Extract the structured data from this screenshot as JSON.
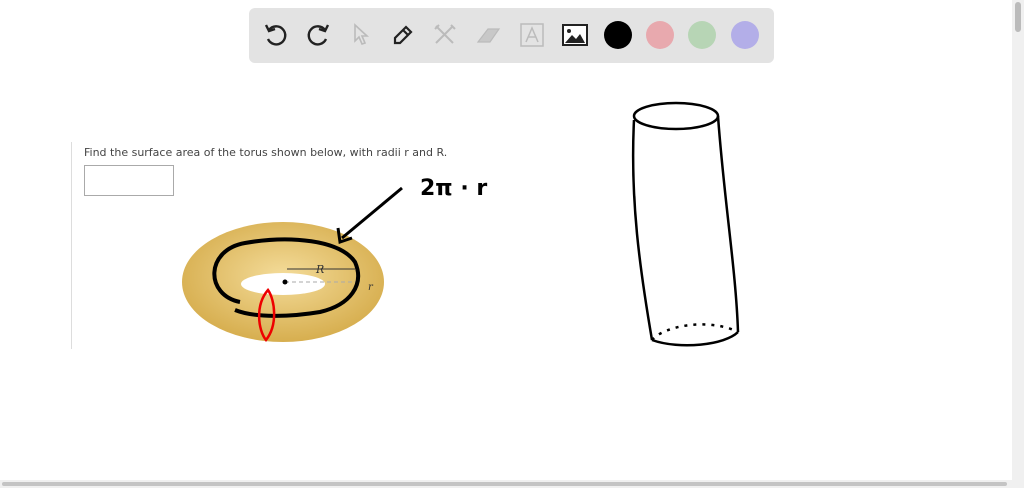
{
  "toolbar": {
    "tools": [
      "undo-icon",
      "redo-icon",
      "pointer-icon",
      "pen-icon",
      "tools-icon",
      "eraser-icon",
      "text-icon",
      "image-icon"
    ],
    "colors": [
      "#000000",
      "#e8a9ae",
      "#b7d5b5",
      "#b3aee8"
    ]
  },
  "question": {
    "text": "Find the surface area of the torus shown below, with radii r and R.",
    "answer_value": "",
    "label_R": "R",
    "label_r": "r"
  },
  "annotation": {
    "handwriting": "2π · r"
  }
}
